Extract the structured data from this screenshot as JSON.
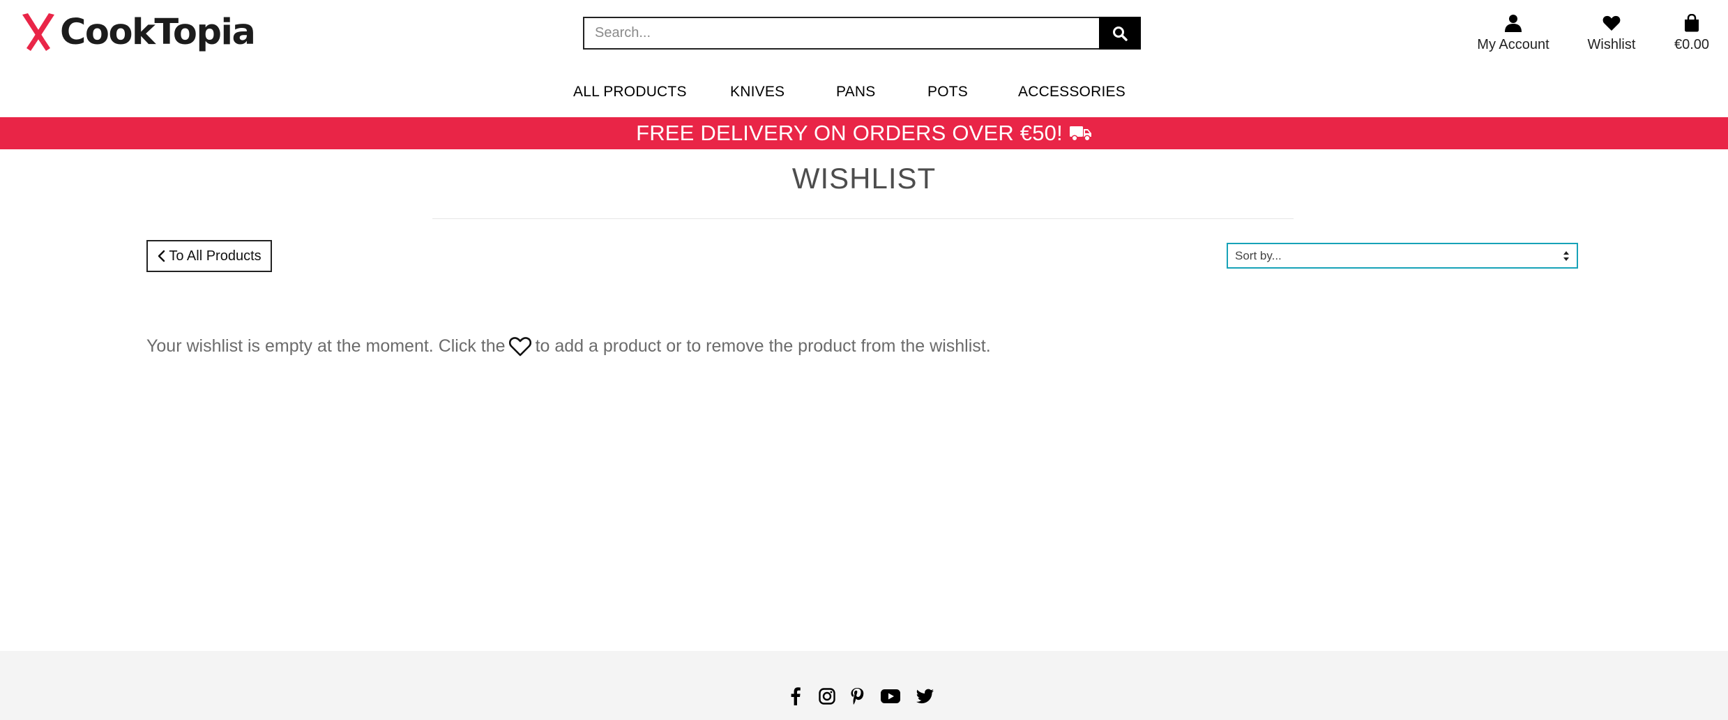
{
  "header": {
    "logo_text": "CookTopia",
    "search_placeholder": "Search...",
    "account_label": "My Account",
    "wishlist_label": "Wishlist",
    "bag_total": "€0.00"
  },
  "nav": {
    "items": [
      "ALL PRODUCTS",
      "KNIVES",
      "PANS",
      "POTS",
      "ACCESSORIES"
    ]
  },
  "banner": {
    "text": "FREE DELIVERY ON ORDERS OVER €50!",
    "icon": "truck-icon"
  },
  "page": {
    "title": "WISHLIST",
    "back_label": "To All Products",
    "sort_label": "Sort by...",
    "empty_before": "Your wishlist is empty at the moment. Click the",
    "empty_after": "to add a product or to remove the product from the wishlist."
  },
  "footer": {
    "social_icons": [
      "facebook-icon",
      "instagram-icon",
      "pinterest-icon",
      "youtube-icon",
      "twitter-icon"
    ]
  },
  "colors": {
    "brand_red": "#e92547",
    "sort_border": "#17a2b8",
    "footer_bg": "#f4f4f4",
    "text_dark": "#222222"
  }
}
